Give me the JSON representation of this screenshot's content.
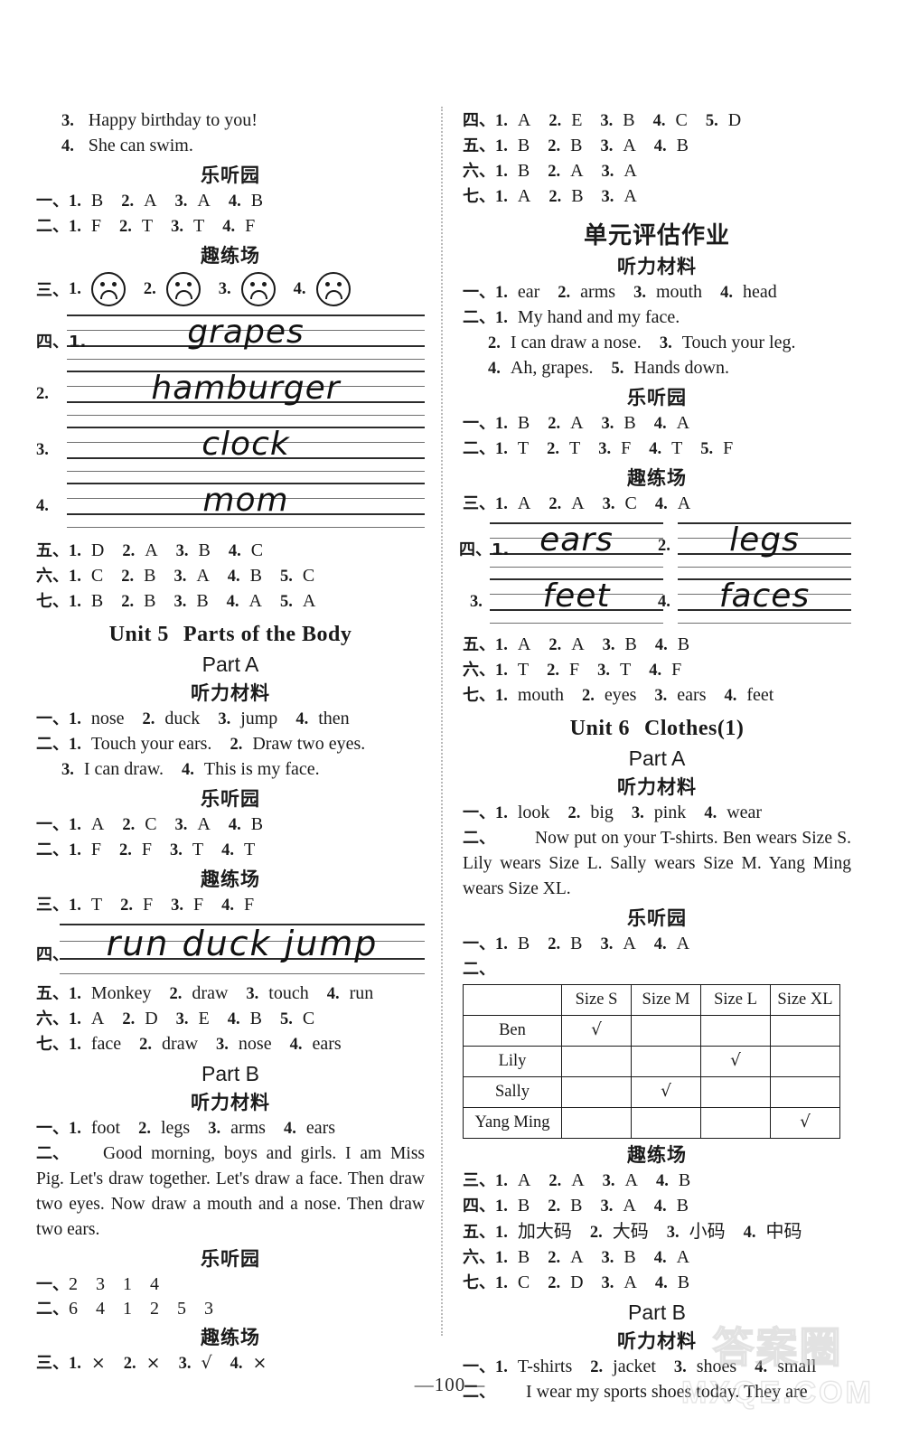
{
  "page": {
    "number": "—100—",
    "watermark_top": "答案圈",
    "watermark_bottom": "MXQE.COM"
  },
  "labels": {
    "cn1": "一、",
    "cn2": "二、",
    "cn3": "三、",
    "cn4": "四、",
    "cn5": "五、",
    "cn6": "六、",
    "cn7": "七、",
    "n1": "1.",
    "n2": "2.",
    "n3": "3.",
    "n4": "4.",
    "n5": "5.",
    "n6": "6.",
    "listening": "听力材料",
    "letingyuan": "乐听园",
    "qulianchang": "趣练场",
    "unit_assessment": "单元评估作业",
    "part_a": "Part A",
    "part_b": "Part B",
    "check": "√",
    "cross": "×"
  },
  "left": {
    "carry_over": {
      "item3": {
        "n": "3.",
        "text": "Happy birthday to you!"
      },
      "item4": {
        "n": "4.",
        "text": "She can swim."
      }
    },
    "sec_leting": {
      "head": "乐听园",
      "rows": [
        {
          "cn": "一、",
          "answers": [
            "B",
            "A",
            "A",
            "B"
          ]
        },
        {
          "cn": "二、",
          "answers": [
            "F",
            "T",
            "T",
            "F"
          ]
        }
      ]
    },
    "sec_qulian": {
      "head": "趣练场",
      "face_row": {
        "cn": "三、",
        "faces": [
          "sad",
          "sad",
          "sad",
          "sad"
        ]
      },
      "handwriting": {
        "cn": "四、",
        "words": [
          "grapes",
          "hamburger",
          "clock",
          "mom"
        ]
      },
      "rows": [
        {
          "cn": "五、",
          "answers": [
            "D",
            "A",
            "B",
            "C"
          ]
        },
        {
          "cn": "六、",
          "answers": [
            "C",
            "B",
            "A",
            "B",
            "C"
          ]
        },
        {
          "cn": "七、",
          "answers": [
            "B",
            "B",
            "B",
            "A",
            "A"
          ]
        }
      ]
    },
    "unit5": {
      "title_unit": "Unit 5",
      "title_name": "Parts of the Body",
      "part_a": {
        "part": "Part A",
        "listening_head": "听力材料",
        "row1": {
          "cn": "一、",
          "answers": [
            "nose",
            "duck",
            "jump",
            "then"
          ]
        },
        "row2_cn": "二、",
        "row2_items": [
          "Touch your ears.",
          "Draw two eyes."
        ],
        "row2_items_b": [
          "I can draw.",
          "This is my face."
        ],
        "leting_head": "乐听园",
        "leting_rows": [
          {
            "cn": "一、",
            "answers": [
              "A",
              "C",
              "A",
              "B"
            ]
          },
          {
            "cn": "二、",
            "answers": [
              "F",
              "F",
              "T",
              "T"
            ]
          }
        ],
        "qulian_head": "趣练场",
        "qulian_row3": {
          "cn": "三、",
          "answers": [
            "T",
            "F",
            "F",
            "F"
          ]
        },
        "handwriting": {
          "cn": "四、",
          "text": "run   duck   jump"
        },
        "qulian_rows": [
          {
            "cn": "五、",
            "answers": [
              "Monkey",
              "draw",
              "touch",
              "run"
            ]
          },
          {
            "cn": "六、",
            "answers": [
              "A",
              "D",
              "E",
              "B",
              "C"
            ]
          },
          {
            "cn": "七、",
            "answers": [
              "face",
              "draw",
              "nose",
              "ears"
            ]
          }
        ]
      },
      "part_b": {
        "part": "Part B",
        "listening_head": "听力材料",
        "row1": {
          "cn": "一、",
          "answers": [
            "foot",
            "legs",
            "arms",
            "ears"
          ]
        },
        "row2_cn": "二、",
        "row2_script": "Good morning, boys and girls. I am Miss Pig. Let's draw together. Let's draw a face. Then draw two eyes. Now draw a mouth and a nose. Then draw two ears.",
        "leting_head": "乐听园",
        "leting_rows": [
          {
            "cn": "一、",
            "seq": [
              "2",
              "3",
              "1",
              "4"
            ]
          },
          {
            "cn": "二、",
            "seq": [
              "6",
              "4",
              "1",
              "2",
              "5",
              "3"
            ]
          }
        ],
        "qulian_head": "趣练场",
        "qulian_row3": {
          "cn": "三、",
          "answers": [
            "×",
            "×",
            "√",
            "×"
          ]
        }
      }
    }
  },
  "right": {
    "carry_over_rows": [
      {
        "cn": "四、",
        "answers": [
          "A",
          "E",
          "B",
          "C",
          "D"
        ]
      },
      {
        "cn": "五、",
        "answers": [
          "B",
          "B",
          "A",
          "B"
        ]
      },
      {
        "cn": "六、",
        "answers": [
          "B",
          "A",
          "A"
        ]
      },
      {
        "cn": "七、",
        "answers": [
          "A",
          "B",
          "A"
        ]
      }
    ],
    "unit_assessment": {
      "title": "单元评估作业",
      "listening_head": "听力材料",
      "row1": {
        "cn": "一、",
        "answers": [
          "ear",
          "arms",
          "mouth",
          "head"
        ]
      },
      "row2_cn": "二、",
      "row2_item1": "My hand and my face.",
      "row2_item2": "I can draw a nose.",
      "row2_item3": "Touch your leg.",
      "row2_item4": "Ah, grapes.",
      "row2_item5": "Hands down.",
      "leting_head": "乐听园",
      "leting_rows": [
        {
          "cn": "一、",
          "answers": [
            "B",
            "A",
            "B",
            "A"
          ]
        },
        {
          "cn": "二、",
          "answers": [
            "T",
            "T",
            "F",
            "T",
            "F"
          ]
        }
      ],
      "qulian_head": "趣练场",
      "qulian_row3": {
        "cn": "三、",
        "answers": [
          "A",
          "A",
          "C",
          "A"
        ]
      },
      "handwriting": {
        "cn": "四、",
        "words": [
          "ears",
          "legs",
          "feet",
          "faces"
        ]
      },
      "qulian_rows": [
        {
          "cn": "五、",
          "answers": [
            "A",
            "A",
            "B",
            "B"
          ]
        },
        {
          "cn": "六、",
          "answers": [
            "T",
            "F",
            "T",
            "F"
          ]
        },
        {
          "cn": "七、",
          "answers": [
            "mouth",
            "eyes",
            "ears",
            "feet"
          ]
        }
      ]
    },
    "unit6": {
      "title_unit": "Unit 6",
      "title_name": "Clothes(1)",
      "part_a": {
        "part": "Part A",
        "listening_head": "听力材料",
        "row1": {
          "cn": "一、",
          "answers": [
            "look",
            "big",
            "pink",
            "wear"
          ]
        },
        "row2_cn": "二、",
        "row2_script": "Now put on your T-shirts. Ben wears Size S. Lily wears Size L. Sally wears Size M. Yang Ming wears Size XL.",
        "leting_head": "乐听园",
        "leting_row1": {
          "cn": "一、",
          "answers": [
            "B",
            "B",
            "A",
            "A"
          ]
        },
        "table_cn": "二、",
        "table": {
          "columns": [
            "",
            "Size S",
            "Size M",
            "Size L",
            "Size XL"
          ],
          "rows": [
            {
              "name": "Ben",
              "marks": [
                "√",
                "",
                "",
                ""
              ]
            },
            {
              "name": "Lily",
              "marks": [
                "",
                "",
                "√",
                ""
              ]
            },
            {
              "name": "Sally",
              "marks": [
                "",
                "√",
                "",
                ""
              ]
            },
            {
              "name": "Yang Ming",
              "marks": [
                "",
                "",
                "",
                "√"
              ]
            }
          ]
        },
        "qulian_head": "趣练场",
        "qulian_rows": [
          {
            "cn": "三、",
            "answers": [
              "A",
              "A",
              "A",
              "B"
            ]
          },
          {
            "cn": "四、",
            "answers": [
              "B",
              "B",
              "A",
              "B"
            ]
          },
          {
            "cn": "五、",
            "answers": [
              "加大码",
              "大码",
              "小码",
              "中码"
            ]
          },
          {
            "cn": "六、",
            "answers": [
              "B",
              "A",
              "B",
              "A"
            ]
          },
          {
            "cn": "七、",
            "answers": [
              "C",
              "D",
              "A",
              "B"
            ]
          }
        ]
      },
      "part_b": {
        "part": "Part B",
        "listening_head": "听力材料",
        "row1": {
          "cn": "一、",
          "answers": [
            "T-shirts",
            "jacket",
            "shoes",
            "small"
          ]
        },
        "row2_cn": "二、",
        "row2_script": "I wear my sports shoes today. They are"
      }
    }
  }
}
